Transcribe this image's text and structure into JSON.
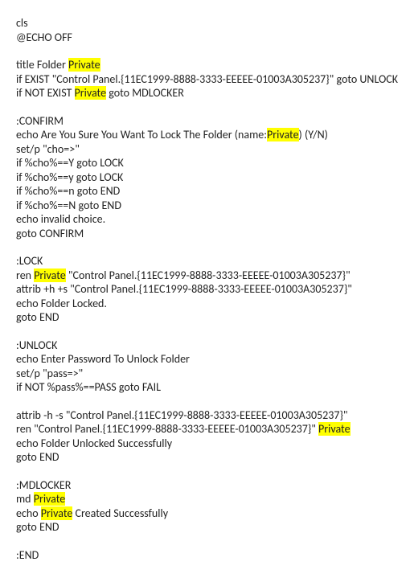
{
  "highlight_word": "Private",
  "lines": [
    {
      "t": "cls"
    },
    {
      "t": "@ECHO OFF"
    },
    {
      "blank": true
    },
    {
      "parts": [
        "title Folder ",
        {
          "hl": "Private"
        }
      ]
    },
    {
      "t": "if EXIST \"Control Panel.{11EC1999-8888-3333-EEEEE-01003A305237}\" goto UNLOCK"
    },
    {
      "parts": [
        "if NOT EXIST ",
        {
          "hl": "Private"
        },
        " goto MDLOCKER"
      ]
    },
    {
      "blank": true
    },
    {
      "t": ":CONFIRM"
    },
    {
      "parts": [
        "echo Are You Sure You Want To Lock The Folder (name:",
        {
          "hl": "Private"
        },
        ") (Y/N)"
      ]
    },
    {
      "t": "set/p \"cho=>\""
    },
    {
      "t": "if %cho%==Y goto LOCK"
    },
    {
      "t": "if %cho%==y goto LOCK"
    },
    {
      "t": "if %cho%==n goto END"
    },
    {
      "t": "if %cho%==N goto END"
    },
    {
      "t": "echo invalid choice."
    },
    {
      "t": "goto CONFIRM"
    },
    {
      "blank": true
    },
    {
      "t": ":LOCK"
    },
    {
      "parts": [
        "ren ",
        {
          "hl": "Private"
        },
        " \"Control Panel.{11EC1999-8888-3333-EEEEE-01003A305237}\""
      ]
    },
    {
      "t": "attrib +h +s \"Control Panel.{11EC1999-8888-3333-EEEEE-01003A305237}\""
    },
    {
      "t": "echo Folder Locked."
    },
    {
      "t": "goto END"
    },
    {
      "blank": true
    },
    {
      "t": ":UNLOCK"
    },
    {
      "t": "echo Enter Password To Unlock Folder"
    },
    {
      "t": "set/p \"pass=>\""
    },
    {
      "t": "if NOT %pass%==PASS goto FAIL"
    },
    {
      "blank": true
    },
    {
      "t": "attrib -h -s \"Control Panel.{11EC1999-8888-3333-EEEEE-01003A305237}\""
    },
    {
      "parts": [
        "ren \"Control Panel.{11EC1999-8888-3333-EEEEE-01003A305237}\" ",
        {
          "hl": "Private"
        }
      ]
    },
    {
      "t": "echo Folder Unlocked Successfully"
    },
    {
      "t": "goto END"
    },
    {
      "blank": true
    },
    {
      "t": ":MDLOCKER"
    },
    {
      "parts": [
        "md ",
        {
          "hl": "Private"
        }
      ]
    },
    {
      "parts": [
        "echo ",
        {
          "hl": "Private"
        },
        " Created Successfully"
      ]
    },
    {
      "t": "goto END"
    },
    {
      "blank": true
    },
    {
      "t": ":END"
    }
  ]
}
